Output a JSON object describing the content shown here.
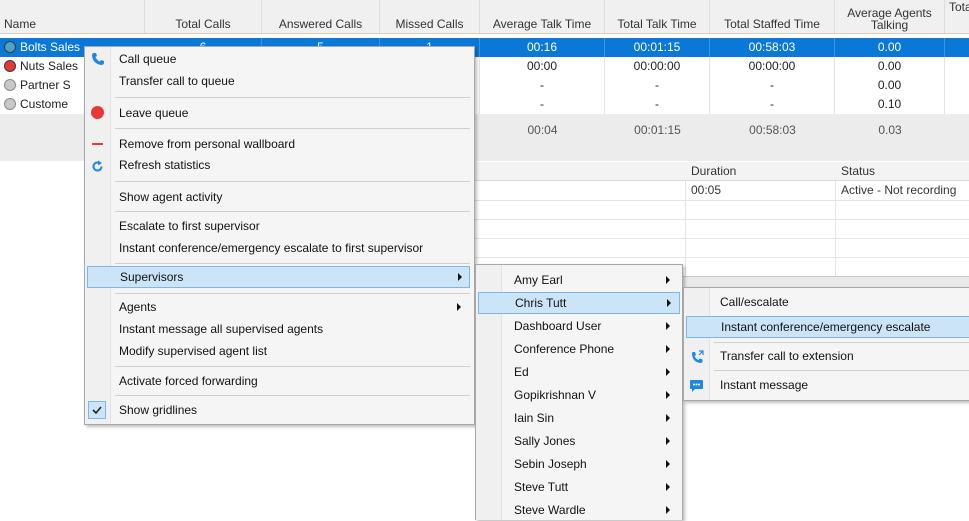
{
  "queue_grid": {
    "columns": [
      "Name",
      "Total Calls",
      "Answered Calls",
      "Missed Calls",
      "Average Talk Time",
      "Total Talk Time",
      "Total Staffed Time",
      "Average Agents Talking",
      "Tota"
    ],
    "rows": [
      {
        "name": "Bolts Sales",
        "status_color": "#4aa3c9",
        "total_calls": "6",
        "answered": "5",
        "missed": "1",
        "avg_talk": "00:16",
        "total_talk": "00:01:15",
        "staffed": "00:58:03",
        "agents_talking": "0.00",
        "selected": true
      },
      {
        "name": "Nuts Sales",
        "status_color": "#e53935",
        "total_calls": "",
        "answered": "",
        "missed": "",
        "avg_talk": "00:00",
        "total_talk": "00:00:00",
        "staffed": "00:00:00",
        "agents_talking": "0.00",
        "selected": false
      },
      {
        "name": "Partner S",
        "status_color": "#c8c8c8",
        "total_calls": "",
        "answered": "",
        "missed": "",
        "avg_talk": "-",
        "total_talk": "-",
        "staffed": "-",
        "agents_talking": "0.00",
        "selected": false
      },
      {
        "name": "Custome",
        "status_color": "#c8c8c8",
        "total_calls": "",
        "answered": "",
        "missed": "",
        "avg_talk": "-",
        "total_talk": "-",
        "staffed": "-",
        "agents_talking": "0.10",
        "selected": false
      }
    ],
    "totals": {
      "avg_talk": "00:04",
      "total_talk": "00:01:15",
      "staffed": "00:58:03",
      "agents_talking": "0.03"
    }
  },
  "calls_grid": {
    "columns": [
      "Duration",
      "Status"
    ],
    "rows": [
      {
        "duration": "00:05",
        "status": "Active - Not recording"
      }
    ]
  },
  "context_menu": {
    "items": [
      {
        "label": "Call queue",
        "icon": "phone-icon"
      },
      {
        "label": "Transfer call to queue"
      },
      {
        "label": "Leave queue",
        "icon": "leave-queue-icon"
      },
      {
        "label": "Remove from personal wallboard",
        "icon": "remove-icon"
      },
      {
        "label": "Refresh statistics",
        "icon": "refresh-icon"
      },
      {
        "label": "Show agent activity"
      },
      {
        "label": "Escalate to first supervisor"
      },
      {
        "label": "Instant conference/emergency escalate to first supervisor"
      },
      {
        "label": "Supervisors",
        "submenu": true,
        "highlighted": true
      },
      {
        "label": "Agents",
        "submenu": true
      },
      {
        "label": "Instant message all supervised agents"
      },
      {
        "label": "Modify supervised agent list"
      },
      {
        "label": "Activate forced forwarding"
      },
      {
        "label": "Show gridlines",
        "checked": true
      }
    ]
  },
  "supervisors_menu": {
    "items": [
      "Amy Earl",
      "Chris Tutt",
      "Dashboard User",
      "Conference Phone",
      "Ed",
      "Gopikrishnan V",
      "Iain Sin",
      "Sally Jones",
      "Sebin Joseph",
      "Steve Tutt",
      "Steve Wardle"
    ],
    "highlighted": "Chris Tutt"
  },
  "supervisor_actions_menu": {
    "items": [
      {
        "label": "Call/escalate"
      },
      {
        "label": "Instant conference/emergency escalate",
        "highlighted": true
      },
      {
        "label": "Transfer call to extension",
        "icon": "transfer-phone-icon"
      },
      {
        "label": "Instant message",
        "icon": "chat-bubble-icon"
      }
    ]
  },
  "colors": {
    "selection": "#0a78d7",
    "menu_highlight": "#cce4f7",
    "accent_icon": "#1e88e5",
    "leave_red": "#e53935"
  }
}
